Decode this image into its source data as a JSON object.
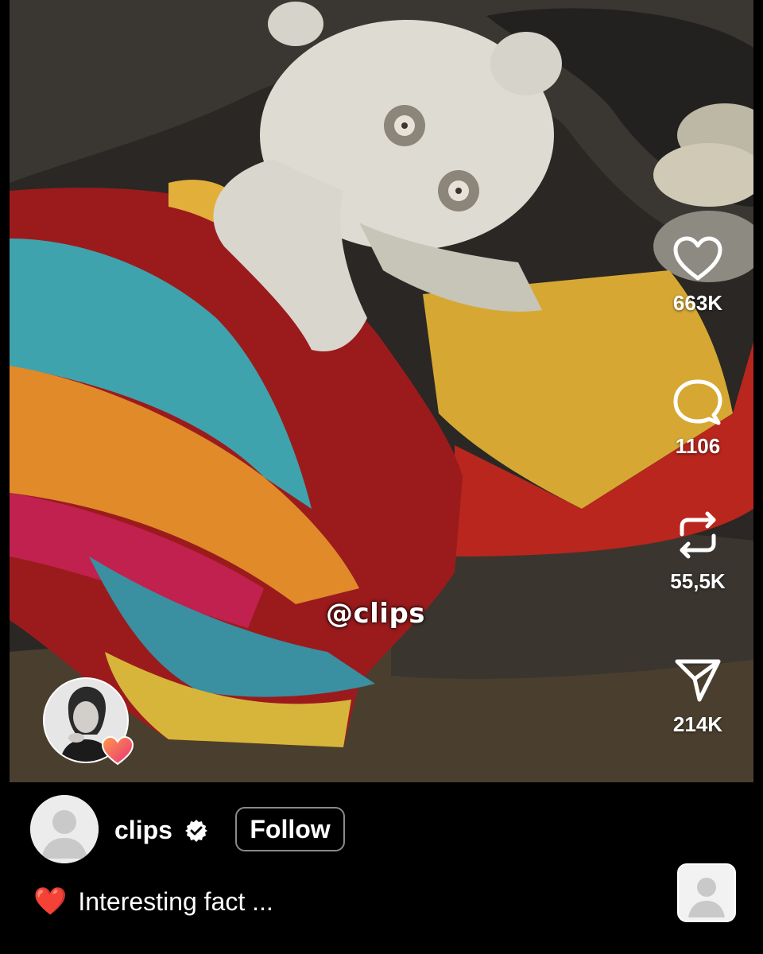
{
  "video": {
    "watermark": "@clips"
  },
  "actions": {
    "like_count": "663K",
    "comment_count": "1106",
    "repost_count": "55,5K",
    "share_count": "214K"
  },
  "author": {
    "username": "clips",
    "verified": true,
    "follow_label": "Follow"
  },
  "caption": {
    "emoji": "❤️",
    "text": "Interesting fact ..."
  },
  "icons": {
    "like": "heart-icon",
    "comment": "comment-bubble-icon",
    "repost": "repost-icon",
    "share": "send-icon",
    "more": "more-options-icon",
    "verified": "verified-badge-icon"
  },
  "colors": {
    "background": "#000000",
    "text": "#ffffff",
    "follow_border": "#8a8a8a"
  }
}
